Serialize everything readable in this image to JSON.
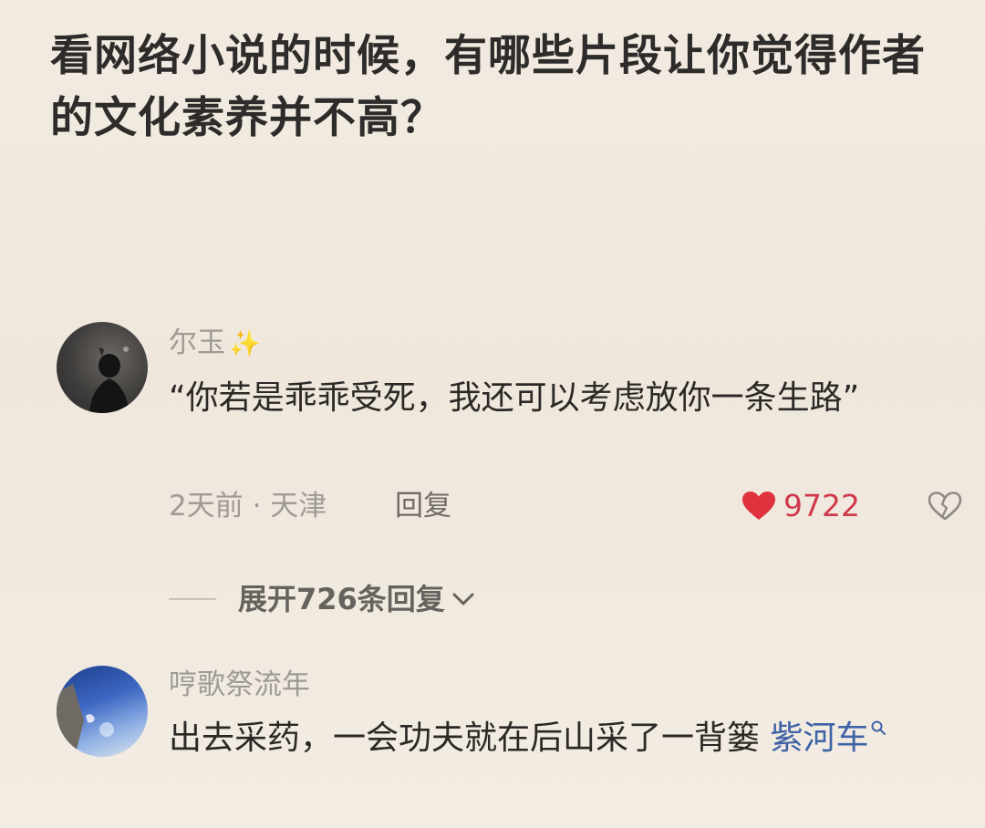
{
  "question": {
    "title": "看网络小说的时候，有哪些片段让你觉得作者的文化素养并不高？"
  },
  "comments": [
    {
      "username": "尔玉",
      "username_badge": "✨",
      "text": "“你若是乖乖受死，我还可以考虑放你一条生路”",
      "meta": "2天前 · 天津",
      "reply_label": "回复",
      "likes": "9722",
      "expand_label": "展开726条回复"
    },
    {
      "username": "哼歌祭流年",
      "text": "出去采药，一会功夫就在后山采了一背篓 ",
      "topic_link": "紫河车"
    }
  ],
  "colors": {
    "background": "#f1eadf",
    "title_text": "#2e2c2a",
    "secondary_text": "#9e9a95",
    "like_red": "#d0394a",
    "topic_blue": "#3f63a6"
  },
  "icons": {
    "like": "heart-icon",
    "dislike": "broken-heart-icon",
    "expand": "chevron-down-icon",
    "topic_search": "search-icon"
  }
}
